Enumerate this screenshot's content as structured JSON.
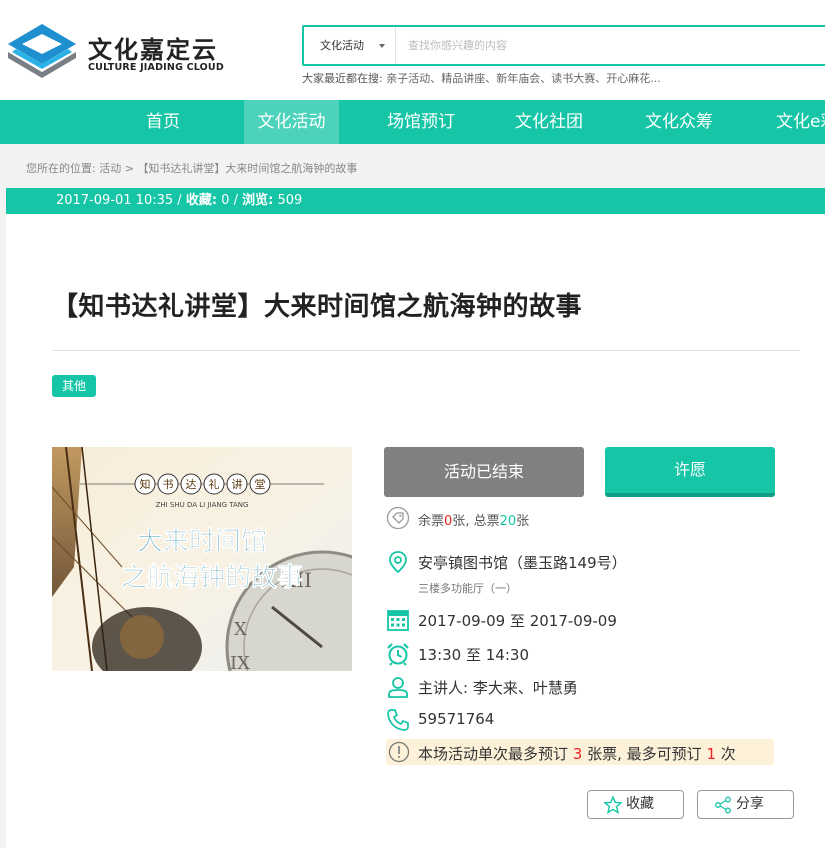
{
  "header": {
    "logo_cn": "文化嘉定云",
    "logo_en": "CULTURE JIADING CLOUD",
    "search_category": "文化活动",
    "search_placeholder": "查找你感兴趣的内容",
    "hot_label": "大家最近都在搜:",
    "hot_terms": "亲子活动、精品讲座、新年庙会、读书大赛、开心麻花..."
  },
  "nav": {
    "items": [
      {
        "label": "首页"
      },
      {
        "label": "文化活动"
      },
      {
        "label": "场馆预订"
      },
      {
        "label": "文化社团"
      },
      {
        "label": "文化众筹"
      },
      {
        "label": "文化e彩"
      }
    ],
    "active_index": 1
  },
  "breadcrumb": {
    "prefix": "您所在的位置:",
    "level1": "活动",
    "sep": ">",
    "current": "【知书达礼讲堂】大来时间馆之航海钟的故事"
  },
  "meta": {
    "datetime": "2017-09-01 10:35",
    "fav_label": "收藏:",
    "fav_count": "0",
    "view_label": "浏览:",
    "view_count": "509"
  },
  "event": {
    "title": "【知书达礼讲堂】大来时间馆之航海钟的故事",
    "tag": "其他",
    "poster": {
      "series_cn": "知书达礼讲堂",
      "series_pinyin": "ZHI SHU DA LI JIANG TANG",
      "line1": "大来时间馆",
      "line2": "之航海钟的故事"
    },
    "status_button": "活动已结束",
    "wish_button": "许愿",
    "tickets": {
      "remain_label": "余票",
      "remain": "0",
      "unit": "张",
      "total_label": ", 总票",
      "total": "20"
    },
    "venue": "安亭镇图书馆（墨玉路149号）",
    "room": "三楼多功能厅（一）",
    "date": "2017-09-09 至 2017-09-09",
    "time": "13:30 至 14:30",
    "speaker": "主讲人: 李大来、叶慧勇",
    "phone": "59571764",
    "notice": {
      "prefix": "本场活动单次最多预订",
      "per_order": "3",
      "mid": "张票, 最多可预订",
      "max_orders": "1",
      "suffix": "次"
    },
    "fav_button": "收藏",
    "share_button": "分享"
  },
  "colors": {
    "accent": "#15c5a6",
    "nav_active": "#4dd3bb",
    "ended_gray": "#808080",
    "notice_bg": "#fdf2d9",
    "highlight_red": "#e22222"
  }
}
